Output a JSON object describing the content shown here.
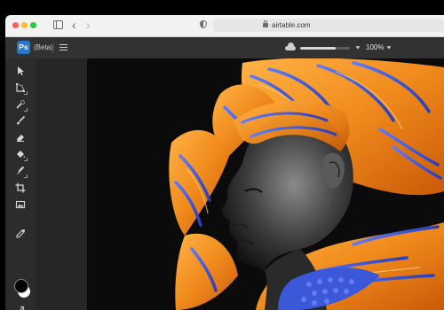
{
  "browser": {
    "url": "airtable.com"
  },
  "app": {
    "logo": "Ps",
    "badge": "(Beta)",
    "zoom": "100%",
    "cloud_sync_progress": 0.72
  },
  "toolbar": {
    "tools": [
      {
        "icon": "move-icon"
      },
      {
        "icon": "transform-icon"
      },
      {
        "icon": "quick-selection-icon"
      },
      {
        "icon": "brush-icon"
      },
      {
        "icon": "eraser-icon"
      },
      {
        "icon": "paint-bucket-icon"
      },
      {
        "icon": "clone-stamp-icon"
      },
      {
        "icon": "crop-icon"
      },
      {
        "icon": "place-image-icon"
      },
      {
        "icon": "eyedropper-icon"
      }
    ],
    "foreground_color": "#000000",
    "background_color": "#ffffff"
  },
  "colors": {
    "accent": "#2a77c9",
    "canvas_bg": "#0b0b0b",
    "artwork_orange": "#f08a1c",
    "artwork_blue": "#3a58d8"
  }
}
